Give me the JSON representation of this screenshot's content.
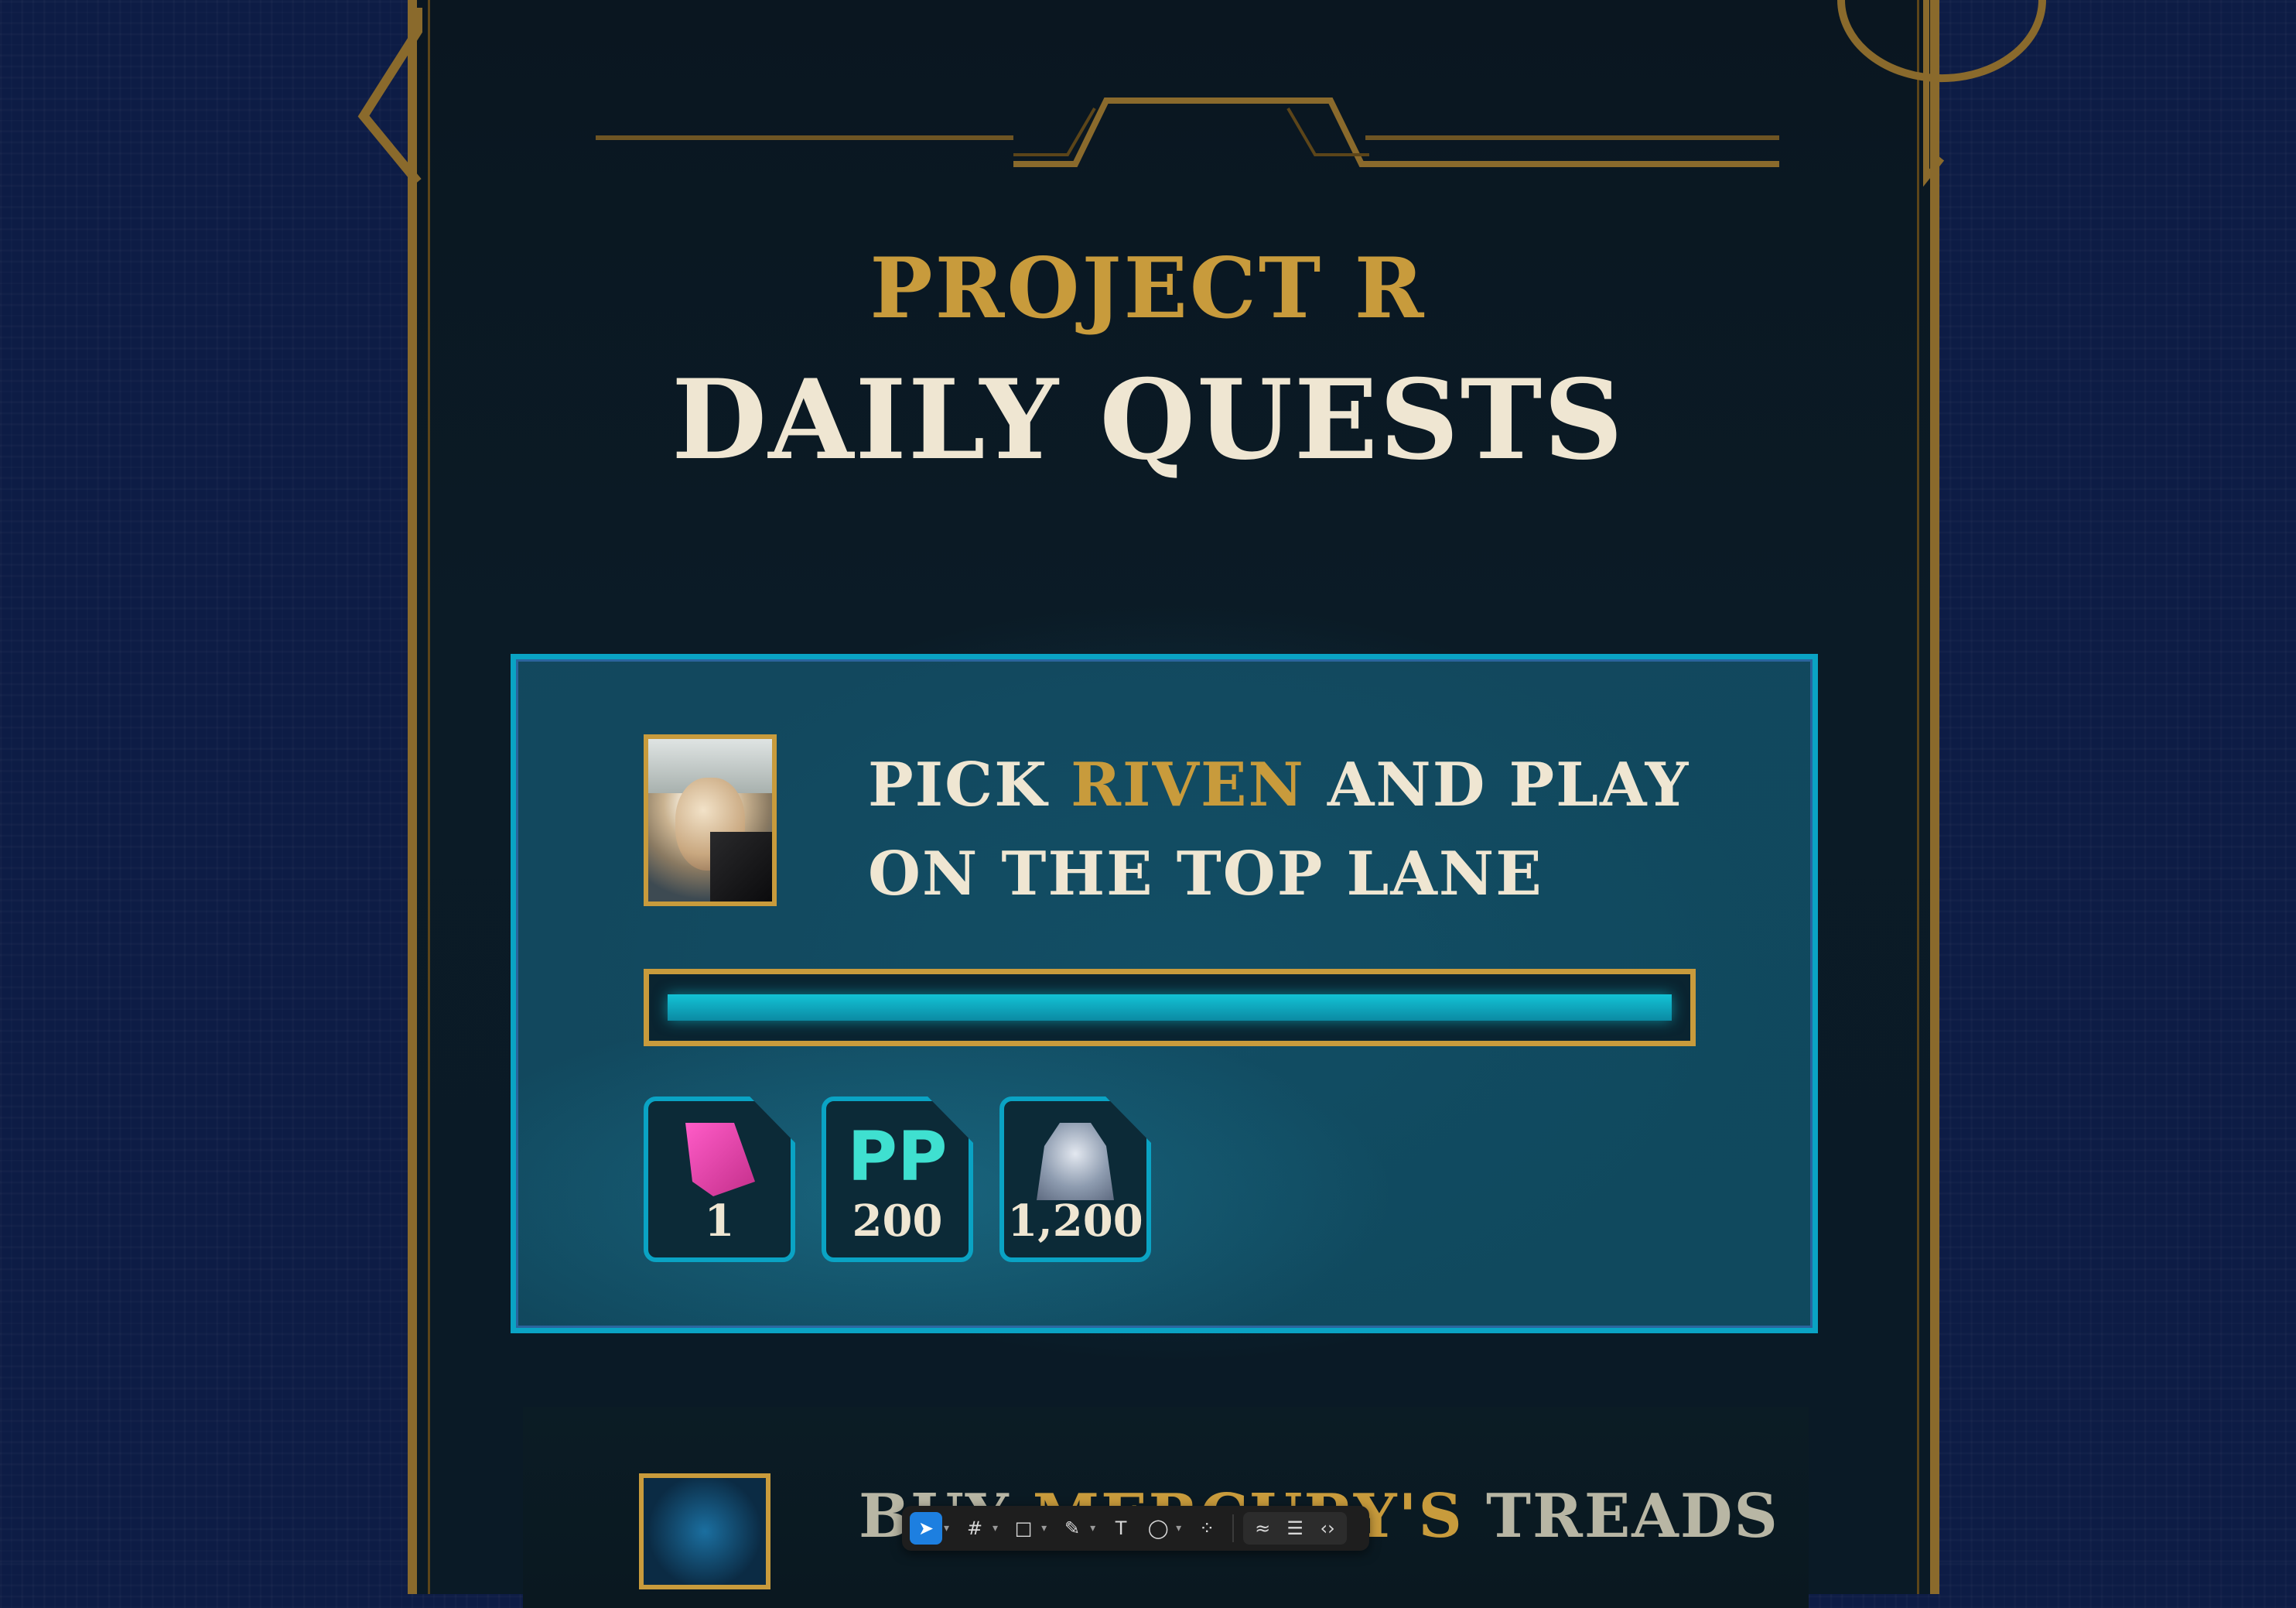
{
  "header": {
    "subtitle": "PROJECT R",
    "title": "DAILY QUESTS"
  },
  "quest1": {
    "text_before": "PICK ",
    "champion": "RIVEN",
    "text_after": " AND PLAY ON THE TOP LANE",
    "progress": 1.0,
    "rewards": [
      {
        "icon": "gem-icon",
        "amount": "1"
      },
      {
        "icon": "pp-icon",
        "label": "PP",
        "amount": "200"
      },
      {
        "icon": "essence-icon",
        "amount": "1,200"
      }
    ]
  },
  "quest2": {
    "text_before": "BUY ",
    "item": "MERCURY'S",
    "text_after": " TREADS"
  },
  "colors": {
    "gold": "#c89b3c",
    "cyan": "#0aa3c4",
    "cream": "#efe6d2",
    "background": "#0d1c45"
  },
  "toolbar": {
    "tools": [
      "pointer-icon",
      "frame-icon",
      "shape-icon",
      "pen-icon",
      "text-icon",
      "comment-icon",
      "components-icon",
      "draw-icon",
      "layers-icon",
      "code-icon"
    ]
  }
}
